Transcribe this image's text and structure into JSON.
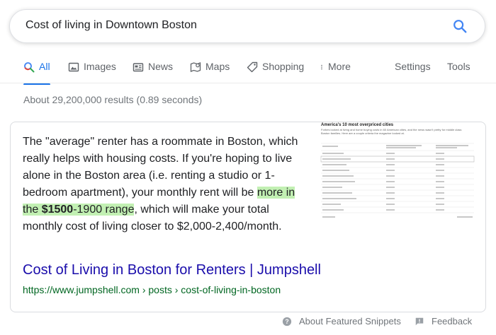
{
  "search": {
    "query": "Cost of living in Downtown Boston",
    "search_icon": "search-icon"
  },
  "tabs": [
    {
      "label": "All",
      "icon": "search-icon",
      "active": true
    },
    {
      "label": "Images",
      "icon": "image-icon"
    },
    {
      "label": "News",
      "icon": "news-icon"
    },
    {
      "label": "Maps",
      "icon": "map-pin-icon"
    },
    {
      "label": "Shopping",
      "icon": "tag-icon"
    },
    {
      "label": "More",
      "icon": "more-vert-icon"
    },
    {
      "label": "Settings"
    },
    {
      "label": "Tools"
    }
  ],
  "result_stats": "About 29,200,000 results (0.89 seconds)",
  "snippet": {
    "text_before": "The \"average\" renter has a roommate in Boston, which really helps with housing costs. If you're hoping to live alone in the Boston area (i.e. renting a studio or 1-bedroom apartment), your monthly rent will be ",
    "highlight_prefix": "more in the ",
    "highlight_bold": "$1500",
    "highlight_suffix": "-1900 range",
    "text_after": ", which will make your total monthly cost of living closer to $2,000-2,400/month.",
    "image": {
      "title": "America's 10 most overpriced cities",
      "subtitle": "Forbes looked at living and home buying costs in 60 American cities, and the news wasn't pretty for middle class Boston families. Here are a couple criteria the magazine looked at.",
      "columns": [
        "Metro area",
        "Percentage of income affordable for the median family",
        "Excess premium over national average"
      ]
    },
    "title": "Cost of Living in Boston for Renters | Jumpshell",
    "url": "https://www.jumpshell.com › posts › cost-of-living-in-boston"
  },
  "footer": {
    "about": "About Featured Snippets",
    "feedback": "Feedback",
    "about_icon": "help-circle-icon",
    "feedback_icon": "feedback-icon"
  },
  "colors": {
    "accent": "#1a73e8",
    "link": "#1a0dab",
    "url": "#006621",
    "highlight": "#c2f0b3"
  }
}
